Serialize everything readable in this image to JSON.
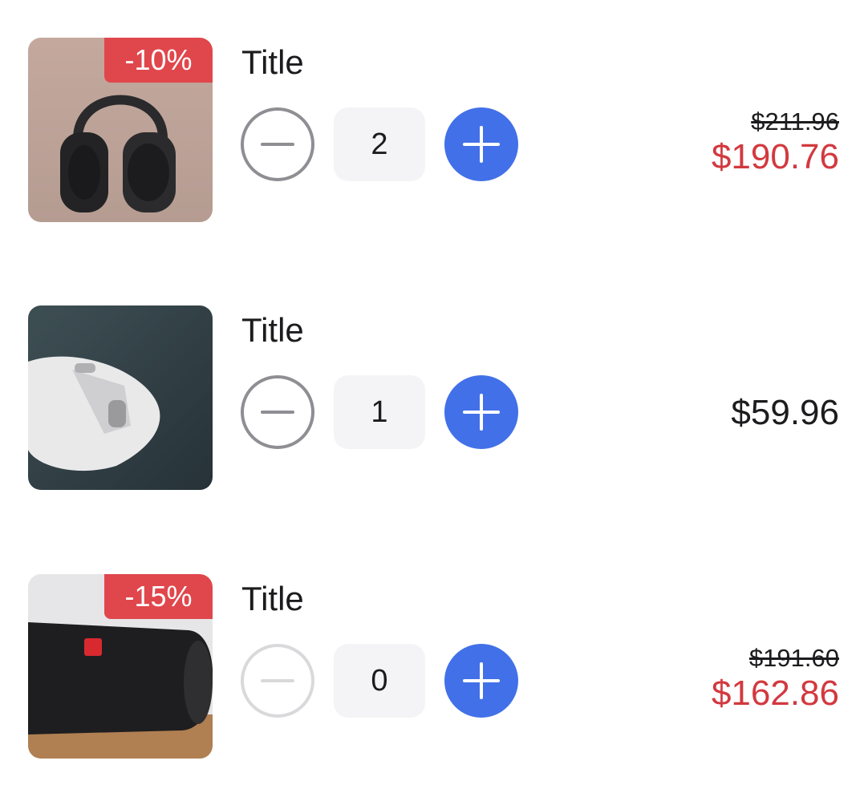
{
  "cart": {
    "items": [
      {
        "title": "Title",
        "image": "headphones-photo",
        "discount_badge": "-10%",
        "quantity": "2",
        "old_price": "$211.96",
        "price": "$190.76",
        "minus_enabled": true
      },
      {
        "title": "Title",
        "image": "mouse-photo",
        "quantity": "1",
        "price": "$59.96",
        "minus_enabled": true
      },
      {
        "title": "Title",
        "image": "speaker-photo",
        "discount_badge": "-15%",
        "quantity": "0",
        "old_price": "$191.60",
        "price": "$162.86",
        "minus_enabled": false
      }
    ]
  },
  "colors": {
    "accent": "#4270e8",
    "discount": "#e0474c",
    "sale_price": "#d2393f",
    "qty_background": "#f4f4f6"
  }
}
